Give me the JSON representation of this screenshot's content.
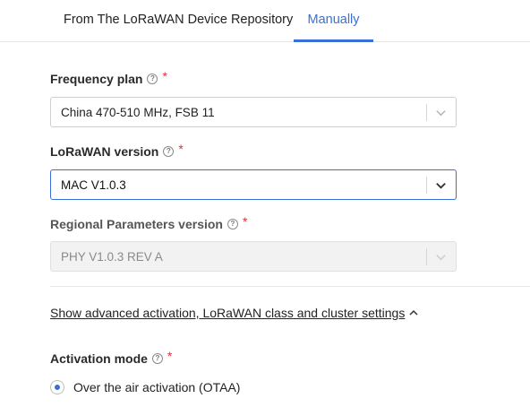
{
  "tabs": [
    {
      "label": "From The LoRaWAN Device Repository",
      "active": false
    },
    {
      "label": "Manually",
      "active": true
    }
  ],
  "fields": {
    "frequency_plan": {
      "label": "Frequency plan",
      "required": "*",
      "value": "China 470-510 MHz, FSB 11"
    },
    "lorawan_version": {
      "label": "LoRaWAN version",
      "required": "*",
      "value": "MAC V1.0.3"
    },
    "regional_params": {
      "label": "Regional Parameters version",
      "required": "*",
      "value": "PHY V1.0.3 REV A"
    }
  },
  "advanced_link": "Show advanced activation, LoRaWAN class and cluster settings",
  "activation_mode": {
    "label": "Activation mode",
    "required": "*",
    "option": "Over the air activation (OTAA)"
  },
  "icons": {
    "help": "help-circle-icon",
    "chevron_down": "chevron-down-icon",
    "chevron_up": "chevron-up-icon"
  },
  "colors": {
    "accent": "#3a6fd8",
    "required": "#d9323a"
  }
}
